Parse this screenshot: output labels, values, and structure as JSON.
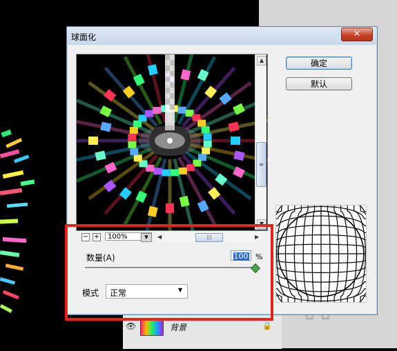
{
  "dialog": {
    "title": "球面化",
    "close_label": "✕",
    "ok_label": "确定",
    "default_label": "默认"
  },
  "zoom": {
    "value": "100%",
    "out_label": "−",
    "in_label": "+"
  },
  "amount": {
    "label": "数量(A)",
    "value": "100",
    "unit": "%",
    "slider_level_percent": 100
  },
  "mode": {
    "label": "模式",
    "value": "正常"
  },
  "layers_panel": {
    "layer_name": "背景"
  },
  "colors": {
    "annotation": "#e8201e",
    "title_bar": "#c8d8ec",
    "dialog_bg": "#f0f0f0"
  },
  "icons": {
    "close": "close-icon",
    "zoom_out": "minus-icon",
    "zoom_in": "plus-icon",
    "eye": "eye-icon",
    "lock": "lock-icon"
  }
}
